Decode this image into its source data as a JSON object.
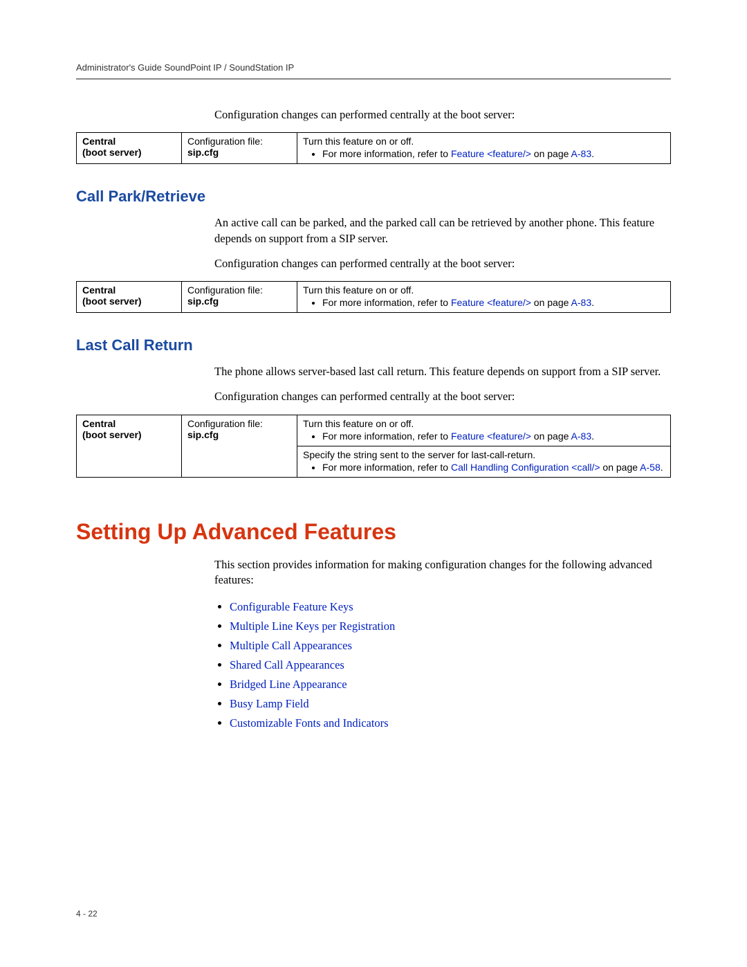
{
  "header": "Administrator's Guide SoundPoint IP / SoundStation IP",
  "intro1": "Configuration changes can performed centrally at the boot server:",
  "table1": {
    "c1a": "Central",
    "c1b": "(boot server)",
    "c2a": "Configuration file:",
    "c2b": "sip.cfg",
    "c3a": "Turn this feature on or off.",
    "c3b_pre": "For more information, refer to ",
    "c3b_link": "Feature <feature/>",
    "c3b_mid": " on page ",
    "c3b_page": "A-83",
    "c3b_post": "."
  },
  "sec1": {
    "title": "Call Park/Retrieve",
    "p1": "An active call can be parked, and the parked call can be retrieved by another phone. This feature depends on support from a SIP server.",
    "p2": "Configuration changes can performed centrally at the boot server:"
  },
  "table2": {
    "c1a": "Central",
    "c1b": "(boot server)",
    "c2a": "Configuration file:",
    "c2b": "sip.cfg",
    "c3a": "Turn this feature on or off.",
    "c3b_pre": "For more information, refer to ",
    "c3b_link": "Feature <feature/>",
    "c3b_mid": " on page ",
    "c3b_page": "A-83",
    "c3b_post": "."
  },
  "sec2": {
    "title": "Last Call Return",
    "p1": "The phone allows server-based last call return. This feature depends on support from a SIP server.",
    "p2": "Configuration changes can performed centrally at the boot server:"
  },
  "table3": {
    "c1a": "Central",
    "c1b": "(boot server)",
    "c2a": "Configuration file:",
    "c2b": "sip.cfg",
    "r1a": "Turn this feature on or off.",
    "r1b_pre": "For more information, refer to ",
    "r1b_link": "Feature <feature/>",
    "r1b_mid": " on page ",
    "r1b_page": "A-83",
    "r1b_post": ".",
    "r2a": "Specify the string sent to the server for last-call-return.",
    "r2b_pre": "For more information, refer to ",
    "r2b_link": "Call Handling Configuration <call/>",
    "r2b_mid": " on page ",
    "r2b_page": "A-58",
    "r2b_post": "."
  },
  "sec3": {
    "title": "Setting Up Advanced Features",
    "p1": "This section provides information for making configuration changes for the following advanced features:",
    "items": [
      "Configurable Feature Keys",
      "Multiple Line Keys per Registration",
      "Multiple Call Appearances",
      "Shared Call Appearances",
      "Bridged Line Appearance",
      "Busy Lamp Field",
      "Customizable Fonts and Indicators"
    ]
  },
  "pagenum": "4 - 22"
}
